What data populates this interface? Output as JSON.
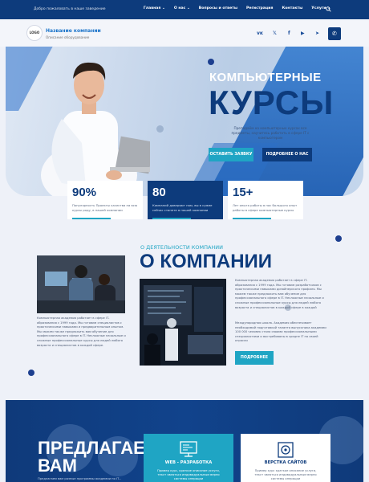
{
  "topbar": {
    "welcome": "Добро пожаловать в наше заведение",
    "nav": [
      {
        "label": "Главная",
        "chevron": true
      },
      {
        "label": "О нас",
        "chevron": true
      },
      {
        "label": "Вопросы и ответы",
        "chevron": false
      },
      {
        "label": "Регистрация",
        "chevron": false
      },
      {
        "label": "Контакты",
        "chevron": false
      },
      {
        "label": "Услуги",
        "chevron": true
      }
    ],
    "search_icon": "search-icon"
  },
  "header": {
    "logo": "LOGO",
    "company_name": "Название компании",
    "company_sub": "Описание оборудование",
    "social": [
      {
        "name": "vk-icon",
        "glyph": "ᴠᴋ"
      },
      {
        "name": "twitter-icon",
        "glyph": "𝕏"
      },
      {
        "name": "facebook-icon",
        "glyph": "f"
      },
      {
        "name": "youtube-icon",
        "glyph": "▶"
      },
      {
        "name": "telegram-icon",
        "glyph": "➤"
      }
    ],
    "phone_glyph": "✆"
  },
  "hero": {
    "title_small": "КОМПЬЮТЕРНЫЕ",
    "title_big": "КУРСЫ",
    "description": "Преподаём на компьютерных курсах все предметы, научитесь работать в сфере IT с компьютером",
    "btn_request": "ОСТАВИТЬ ЗАЯВКУ",
    "btn_more": "ПОДРОБНЕЕ О НАС"
  },
  "stats": [
    {
      "value": "90%",
      "text": "Популярность Проекты качества на всю курсы роду, в нашей компании"
    },
    {
      "value": "80",
      "text": "Компаний доверяют нам, вы в сумме сейчас станете в нашей компании"
    },
    {
      "value": "15+",
      "text": "Лет опыта работы в нас большого опыт работы в сфере компьютерные курсы"
    }
  ],
  "about": {
    "kicker": "О ДЕЯТЕЛЬНОСТИ КОМПАНИИ",
    "title": "О КОМПАНИИ",
    "left_text": "Компьютерная академия работает в сфере IT-образования с 1999 года. Мы готовим специалистов с практическими навыками и предварительным опытом. Мы можем также предложить вам обучение для профессионального сфере в IT. Несложные начальные и сложные профессиональные курсы для людей любого возраста и специалистов в каждой сфере.",
    "right_text1": "Компьютерная академия работает в сфере IT-образования с 1999 года. Мы готовим разработчиков с практическими навыками дизайнерского профиля. Мы можем также предложить вам обучение для профессионального сфере в IT. Несложные начальные и сложные профессиональные курсы для людей любого возраста и специалистов в каждой сфере в каждой",
    "right_text2": "Международная школа. Академия обеспечивает необходимой подготовкой таланта выпускника академии 100 000 человек стала своими профессиональными специалистами и востребованы в средне IT по своей отрасли",
    "btn": "ПОДРОБНЕЕ"
  },
  "offer": {
    "title_line1": "ПРЕДЛАГАЕМ",
    "title_line2": "ВАМ",
    "left_text": "Предлагаем вам разные программы академии по IT...",
    "cards": [
      {
        "title": "WEB - РАЗРАБОТКА",
        "desc": "Пример курс, краткое описание услуги, текст являться индивидуальным верно системы операции",
        "icon": "web-dev-icon"
      },
      {
        "title": "ВЕРСТКА САЙТОВ",
        "desc": "Пример курс краткое описание услуги, текст являться индивидуальным верно системы операции",
        "icon": "layout-icon"
      }
    ]
  },
  "colors": {
    "navy": "#0d3b7c",
    "accent": "#1fa5c4",
    "brand_blue": "#1a73c9"
  }
}
